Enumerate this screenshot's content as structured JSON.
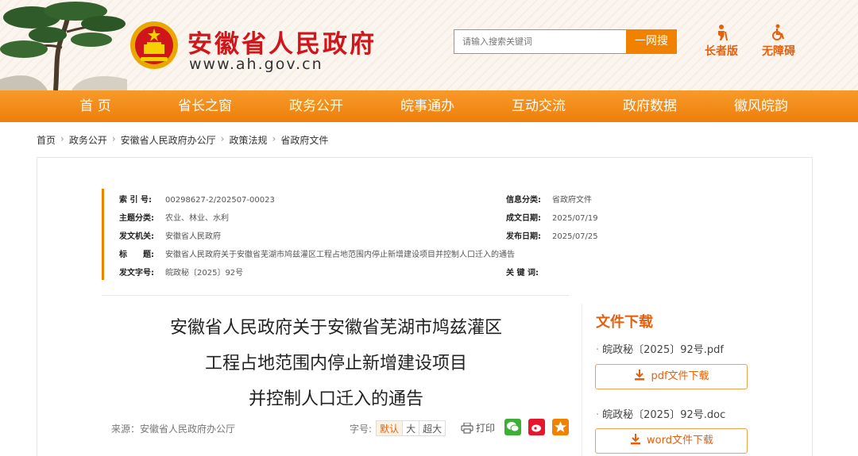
{
  "header": {
    "site_title": "安徽省人民政府",
    "site_url": "www.ah.gov.cn",
    "search_placeholder": "请输入搜索关键词",
    "search_button": "一网搜",
    "elder_mode": "长者版",
    "accessibility": "无障碍"
  },
  "nav": {
    "items": [
      {
        "label": "首 页"
      },
      {
        "label": "省长之窗"
      },
      {
        "label": "政务公开"
      },
      {
        "label": "皖事通办"
      },
      {
        "label": "互动交流"
      },
      {
        "label": "政府数据"
      },
      {
        "label": "徽风皖韵"
      }
    ],
    "active": "政务公开"
  },
  "breadcrumb": [
    "首页",
    "政务公开",
    "安徽省人民政府办公厅",
    "政策法规",
    "省政府文件"
  ],
  "meta": {
    "index_label": "索 引 号:",
    "index_value": "00298627-2/202507-00023",
    "info_class_label": "信息分类:",
    "info_class_value": "省政府文件",
    "topic_label": "主题分类:",
    "topic_value": "农业、林业、水利",
    "date_made_label": "成文日期:",
    "date_made_value": "2025/07/19",
    "issuer_label": "发文机关:",
    "issuer_value": "安徽省人民政府",
    "date_pub_label": "发布日期:",
    "date_pub_value": "2025/07/25",
    "title_label": "标　　题:",
    "title_value": "安徽省人民政府关于安徽省芜湖市鸠兹灌区工程占地范围内停止新增建设项目并控制人口迁入的通告",
    "doc_no_label": "发文字号:",
    "doc_no_value": "皖政秘〔2025〕92号",
    "keywords_label": "关 键 词:",
    "keywords_value": ""
  },
  "document": {
    "title_lines": [
      "安徽省人民政府关于安徽省芜湖市鸠兹灌区",
      "工程占地范围内停止新增建设项目",
      "并控制人口迁入的通告"
    ],
    "source": "来源：安徽省人民政府办公厅",
    "font_size_label": "字号:",
    "font_sizes": [
      "默认",
      "大",
      "超大"
    ],
    "print_label": "打印"
  },
  "downloads": {
    "heading": "文件下载",
    "files": [
      {
        "name": "皖政秘〔2025〕92号.pdf",
        "button": "pdf文件下载"
      },
      {
        "name": "皖政秘〔2025〕92号.doc",
        "button": "word文件下载"
      }
    ]
  },
  "colors": {
    "brand_red": "#d0161b",
    "accent_orange": "#f08200",
    "nav_orange": "#ee7f0b"
  }
}
